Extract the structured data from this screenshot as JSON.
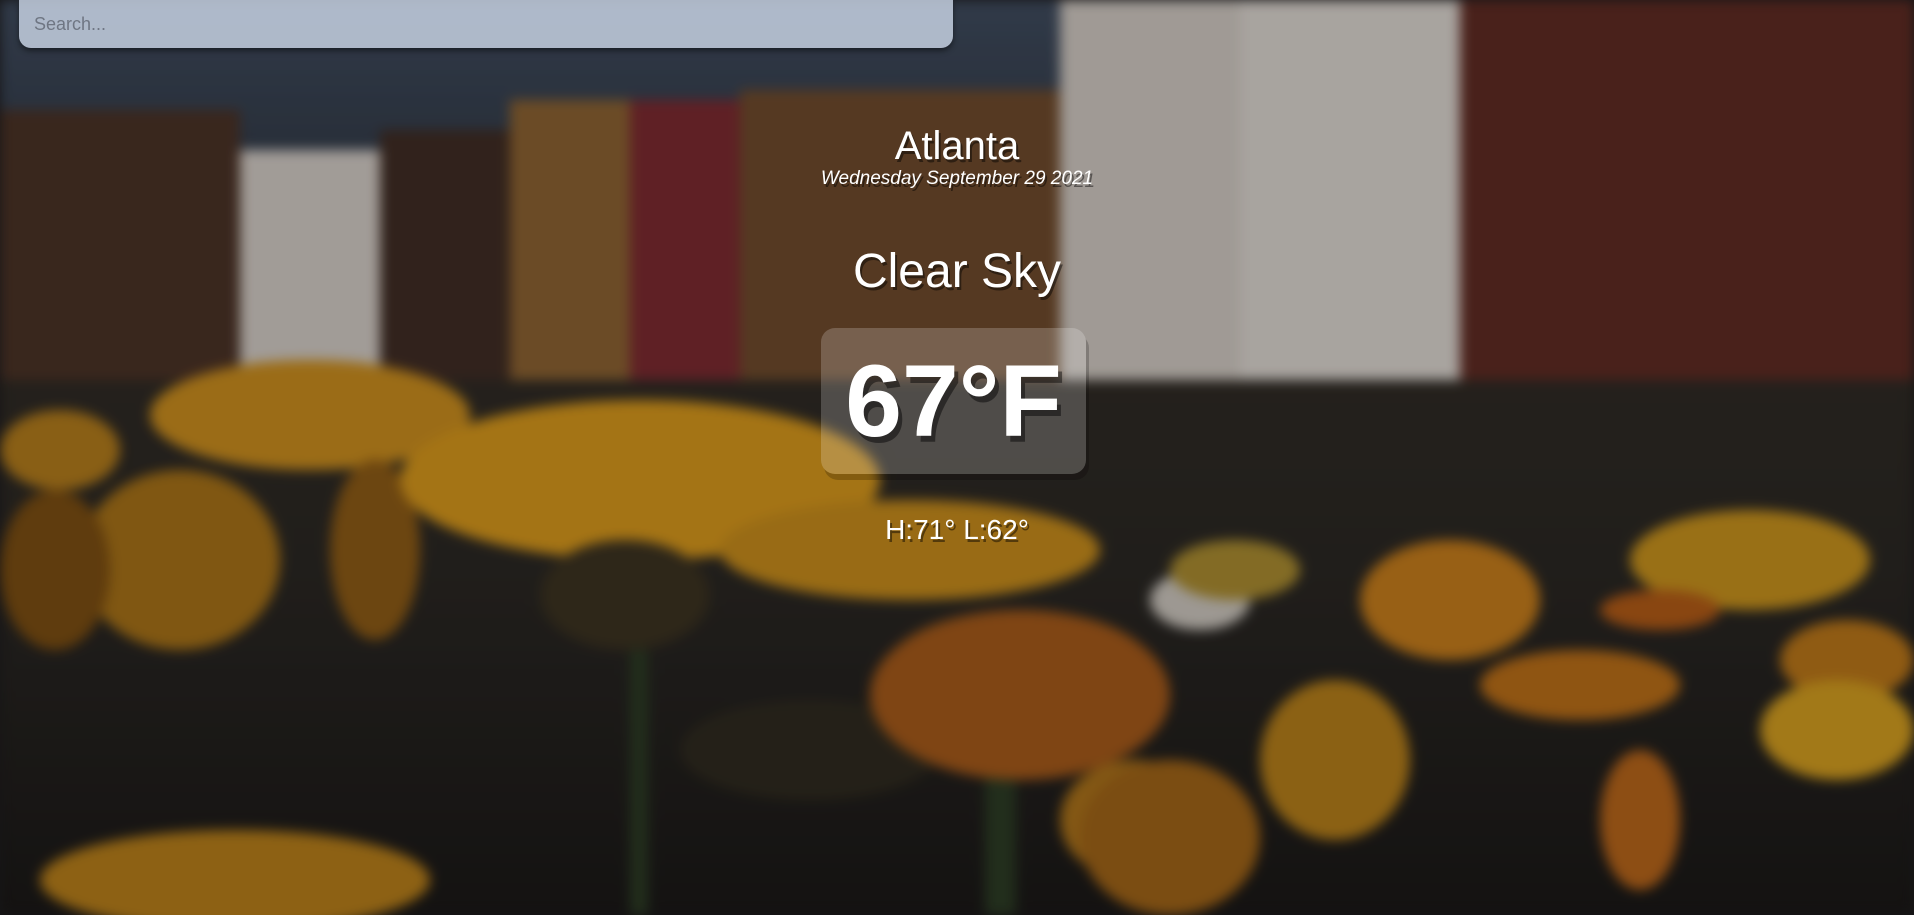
{
  "search": {
    "placeholder": "Search..."
  },
  "location": {
    "city": "Atlanta",
    "date": "Wednesday September 29 2021"
  },
  "weather": {
    "condition": "Clear Sky",
    "temperature": "67°F",
    "high_low": "H:71° L:62°"
  },
  "colors": {
    "text": "#ffffff",
    "search_bg": "#cbd6e6",
    "accent_flower": "#e5a21c"
  }
}
